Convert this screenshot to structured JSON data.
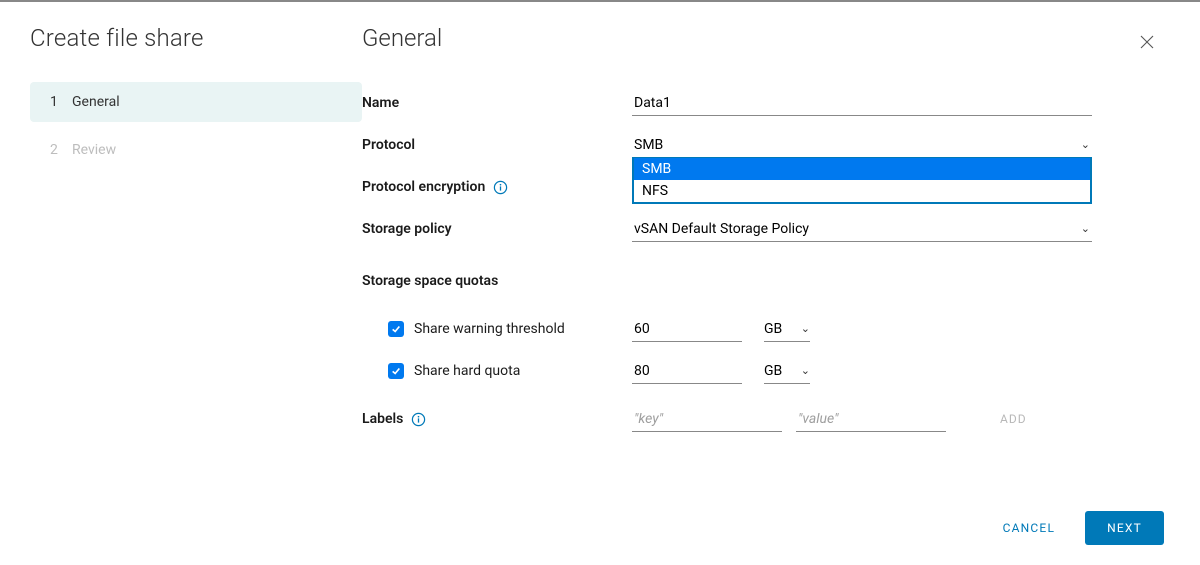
{
  "sidebar": {
    "title": "Create file share",
    "steps": [
      {
        "num": "1",
        "label": "General",
        "active": true
      },
      {
        "num": "2",
        "label": "Review",
        "active": false
      }
    ]
  },
  "main": {
    "title": "General",
    "fields": {
      "name_label": "Name",
      "name_value": "Data1",
      "protocol_label": "Protocol",
      "protocol_value": "SMB",
      "protocol_options": [
        "SMB",
        "NFS"
      ],
      "protocol_encryption_label": "Protocol encryption",
      "storage_policy_label": "Storage policy",
      "storage_policy_value": "vSAN Default Storage Policy",
      "quotas_label": "Storage space quotas",
      "warning_threshold_label": "Share warning threshold",
      "warning_threshold_value": "60",
      "warning_threshold_unit": "GB",
      "hard_quota_label": "Share hard quota",
      "hard_quota_value": "80",
      "hard_quota_unit": "GB",
      "labels_label": "Labels",
      "labels_key_placeholder": "\"key\"",
      "labels_value_placeholder": "\"value\"",
      "add_button": "ADD"
    }
  },
  "footer": {
    "cancel": "CANCEL",
    "next": "NEXT"
  }
}
